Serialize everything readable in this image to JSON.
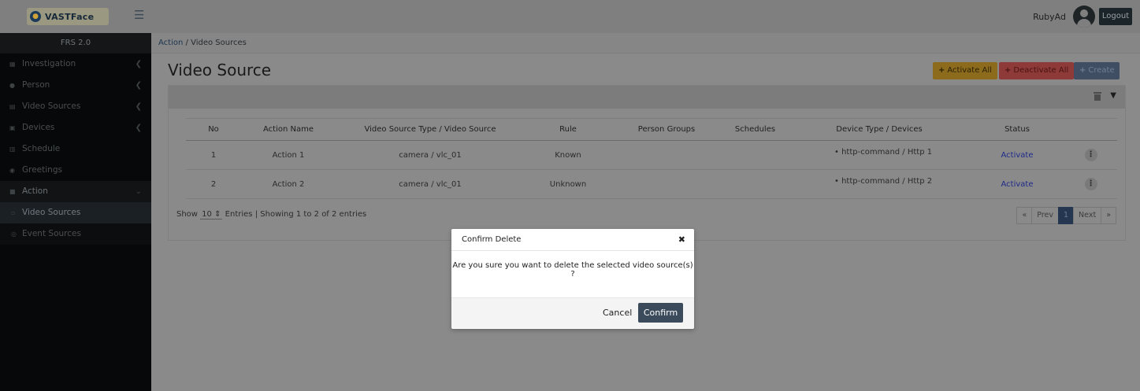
{
  "header": {
    "logo_text": "VASTFace",
    "user_name": "RubyAd",
    "logout_label": "Logout"
  },
  "sidebar": {
    "version": "FRS 2.0",
    "items": [
      {
        "label": "Investigation",
        "icon": "grid-icon"
      },
      {
        "label": "Person",
        "icon": "person-icon"
      },
      {
        "label": "Video Sources",
        "icon": "video-icon"
      },
      {
        "label": "Devices",
        "icon": "device-icon"
      },
      {
        "label": "Schedule",
        "icon": "calendar-icon"
      },
      {
        "label": "Greetings",
        "icon": "comment-icon"
      },
      {
        "label": "Action",
        "icon": "action-icon"
      }
    ],
    "subitems": [
      {
        "label": "Video Sources"
      },
      {
        "label": "Event Sources"
      }
    ]
  },
  "breadcrumb": {
    "parent": "Action",
    "separator": "/",
    "current": "Video Sources"
  },
  "page": {
    "title": "Video Source",
    "activate_all": "Activate All",
    "deactivate_all": "Deactivate All",
    "create": "Create"
  },
  "table": {
    "headers": [
      "No",
      "Action Name",
      "Video Source Type / Video Source",
      "Rule",
      "Person Groups",
      "Schedules",
      "Device Type / Devices",
      "Status"
    ],
    "rows": [
      {
        "no": "1",
        "name": "Action 1",
        "source": "camera  /  vlc_01",
        "rule": "Known",
        "groups": "",
        "schedules": "",
        "device": "• http-command  /  Http 1",
        "status": "Activate"
      },
      {
        "no": "2",
        "name": "Action 2",
        "source": "camera  /  vlc_01",
        "rule": "Unknown",
        "groups": "",
        "schedules": "",
        "device": "• http-command  /  Http 2",
        "status": "Activate"
      }
    ]
  },
  "footer": {
    "show": "Show",
    "entries_value": "10",
    "entries": "Entries",
    "summary": "Showing 1 to 2 of 2 entries",
    "first": "«",
    "prev": "Prev",
    "page": "1",
    "next": "Next",
    "last": "»"
  },
  "modal": {
    "title": "Confirm Delete",
    "message": "Are you sure you want to delete the selected video source(s) ?",
    "cancel": "Cancel",
    "confirm": "Confirm"
  }
}
